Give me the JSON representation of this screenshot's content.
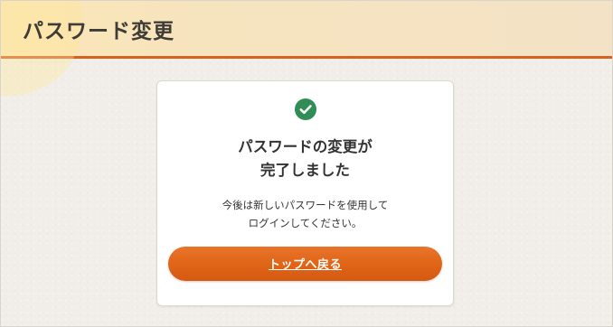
{
  "header": {
    "title": "パスワード変更"
  },
  "card": {
    "icon": "check-circle-icon",
    "heading_lines": [
      "パスワードの変更が",
      "完了しました"
    ],
    "message_lines": [
      "今後は新しいパスワードを使用して",
      "ログインしてください。"
    ],
    "button_label": "トップへ戻る"
  },
  "colors": {
    "accent": "#df6416",
    "success": "#2f8d55",
    "header_bg": "#f7e4bc"
  }
}
